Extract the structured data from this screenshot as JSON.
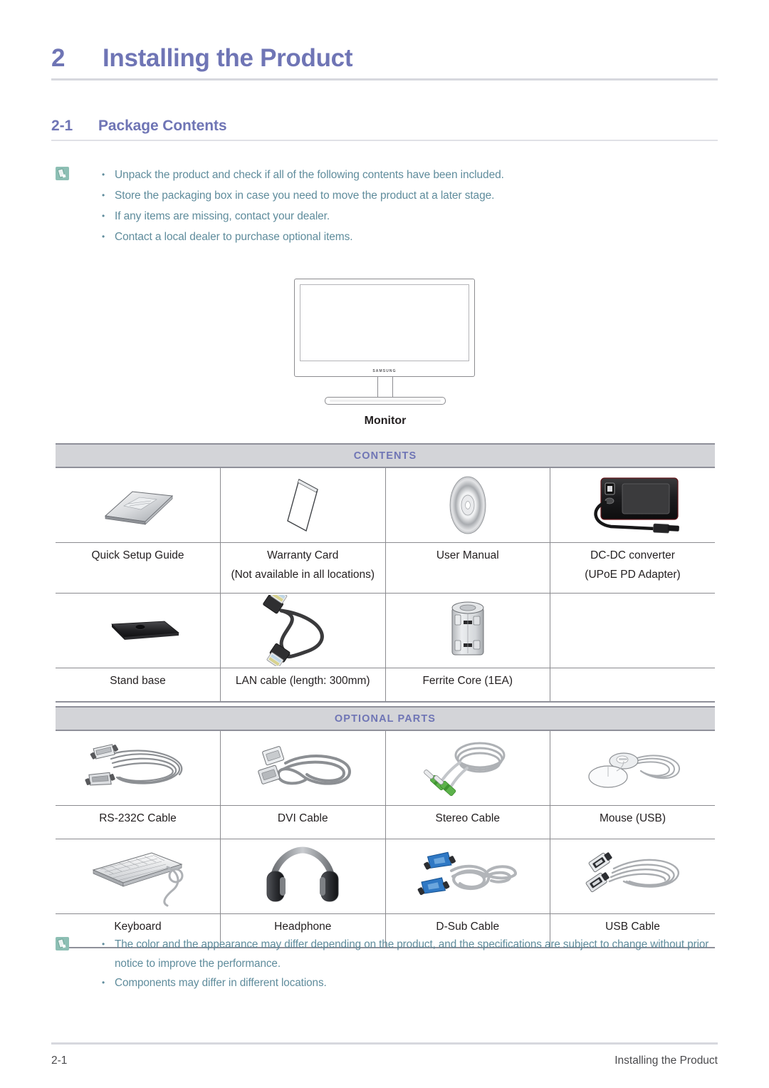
{
  "chapter": {
    "number": "2",
    "title": "Installing the Product"
  },
  "section": {
    "number": "2-1",
    "title": "Package Contents"
  },
  "top_note": {
    "icon": "note-pencil-icon",
    "items": [
      "Unpack the product and check if all of the following contents have been included.",
      "Store the packaging box in case you need to move the product at a later stage.",
      "If any items are missing, contact your dealer.",
      "Contact a local dealer to purchase optional items."
    ]
  },
  "monitor_figure": {
    "brand_logo": "SAMSUNG",
    "caption": "Monitor"
  },
  "contents_table": {
    "band_label": "CONTENTS",
    "rows": [
      [
        {
          "icon": "quick-setup-guide-booklet-icon",
          "label": "Quick Setup Guide",
          "sub": ""
        },
        {
          "icon": "warranty-card-icon",
          "label": "Warranty Card",
          "sub": "(Not available in all locations)"
        },
        {
          "icon": "user-manual-disc-icon",
          "label": "User Manual",
          "sub": ""
        },
        {
          "icon": "dc-dc-converter-icon",
          "label": "DC-DC converter",
          "sub": "(UPoE PD Adapter)"
        }
      ],
      [
        {
          "icon": "stand-base-icon",
          "label": "Stand base",
          "sub": ""
        },
        {
          "icon": "lan-cable-icon",
          "label": "LAN cable (length: 300mm)",
          "sub": ""
        },
        {
          "icon": "ferrite-core-icon",
          "label": "Ferrite Core (1EA)",
          "sub": ""
        },
        {
          "icon": "",
          "label": "",
          "sub": ""
        }
      ]
    ]
  },
  "optional_table": {
    "band_label": "OPTIONAL PARTS",
    "rows": [
      [
        {
          "icon": "rs232c-cable-icon",
          "label": "RS-232C Cable"
        },
        {
          "icon": "dvi-cable-icon",
          "label": "DVI Cable"
        },
        {
          "icon": "stereo-cable-icon",
          "label": "Stereo Cable"
        },
        {
          "icon": "usb-mouse-icon",
          "label": "Mouse (USB)"
        }
      ],
      [
        {
          "icon": "keyboard-icon",
          "label": "Keyboard"
        },
        {
          "icon": "headphone-icon",
          "label": "Headphone"
        },
        {
          "icon": "d-sub-cable-icon",
          "label": "D-Sub Cable"
        },
        {
          "icon": "usb-cable-icon",
          "label": "USB Cable"
        }
      ]
    ]
  },
  "bottom_note": {
    "icon": "note-pencil-icon",
    "items": [
      "The color and the appearance may differ depending on the product, and the specifications are subject to change without prior notice to improve the performance.",
      "Components may differ in different locations."
    ]
  },
  "footer": {
    "page_number": "2-1",
    "chapter_label": "Installing the Product"
  },
  "colors": {
    "heading_purple": "#6f75b5",
    "note_text_blue": "#5f8c9c",
    "band_gray": "#d3d4d8",
    "rule_gray": "#d7d8de",
    "table_border": "#8b8b8f"
  }
}
